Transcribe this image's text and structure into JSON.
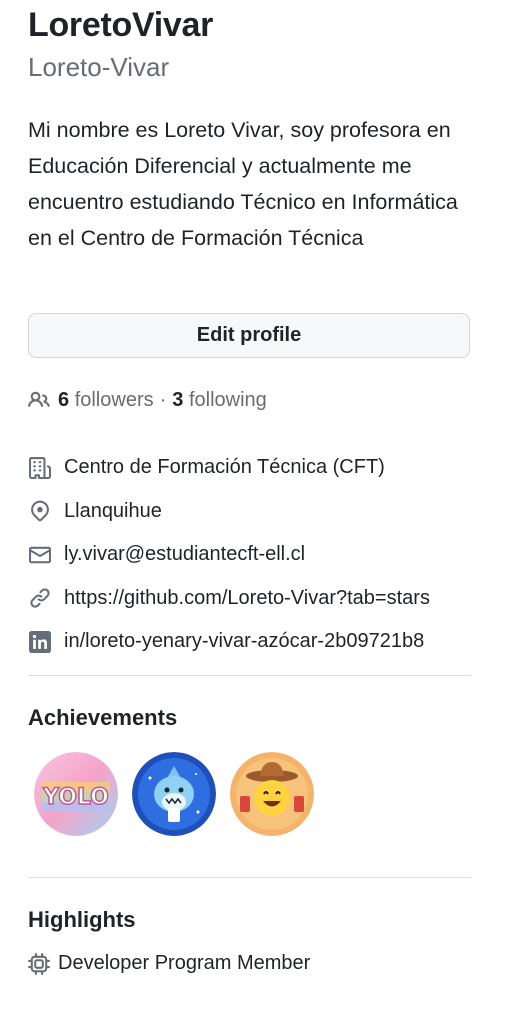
{
  "profile": {
    "name": "LoretoVivar",
    "login": "Loreto-Vivar",
    "bio": "Mi nombre es Loreto Vivar, soy profesora en Educación Diferencial y actualmente me encuentro estudiando Técnico en Informática en el Centro de Formación Técnica",
    "edit_label": "Edit profile"
  },
  "social": {
    "followers_count": "6",
    "followers_label": "followers",
    "separator": "·",
    "following_count": "3",
    "following_label": "following"
  },
  "details": {
    "organization": "Centro de Formación Técnica (CFT)",
    "location": "Llanquihue",
    "email": "ly.vivar@estudiantecft-ell.cl",
    "website": "https://github.com/Loreto-Vivar?tab=stars",
    "linkedin": "in/loreto-yenary-vivar-azócar-2b09721b8"
  },
  "achievements": {
    "title": "Achievements",
    "badges": [
      {
        "icon": "yolo-badge-icon",
        "text": "YOLO"
      },
      {
        "icon": "shark-badge-icon"
      },
      {
        "icon": "cowboy-badge-icon"
      }
    ]
  },
  "highlights": {
    "title": "Highlights",
    "items": [
      {
        "icon": "cpu-icon",
        "label": "Developer Program Member"
      }
    ]
  },
  "colors": {
    "text": "#1f2328",
    "muted": "#656d76",
    "border": "#d0d7de",
    "button_bg": "#f6f8fa",
    "divider": "#d8dee4"
  }
}
